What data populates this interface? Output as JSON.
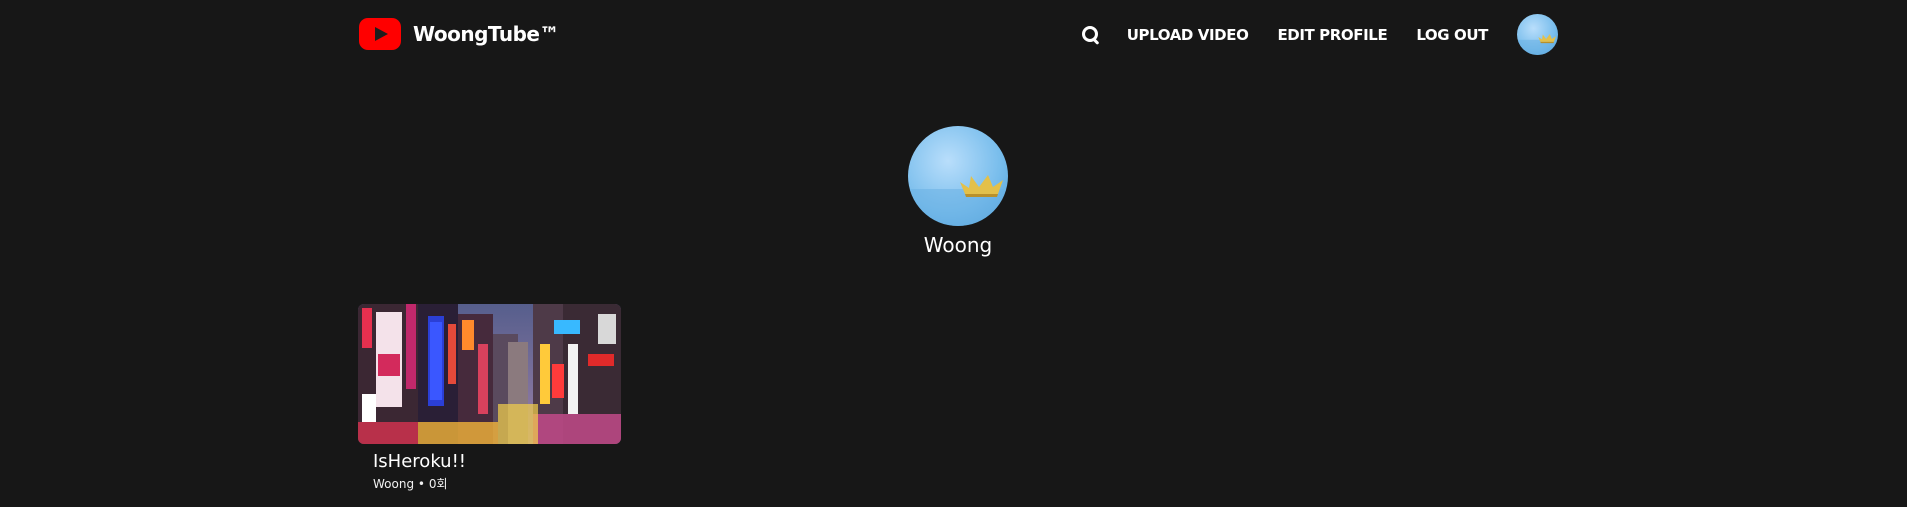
{
  "header": {
    "brand": "WoongTube™",
    "nav": {
      "search_icon": "search-icon",
      "upload_label": "UPLOAD VIDEO",
      "edit_label": "EDIT PROFILE",
      "logout_label": "LOG OUT"
    }
  },
  "profile": {
    "name": "Woong"
  },
  "videos": [
    {
      "title": "IsHeroku!!",
      "author": "Woong",
      "views": "0회"
    }
  ],
  "colors": {
    "background": "#171717",
    "brand_red": "#ff0000",
    "text": "#ffffff"
  }
}
